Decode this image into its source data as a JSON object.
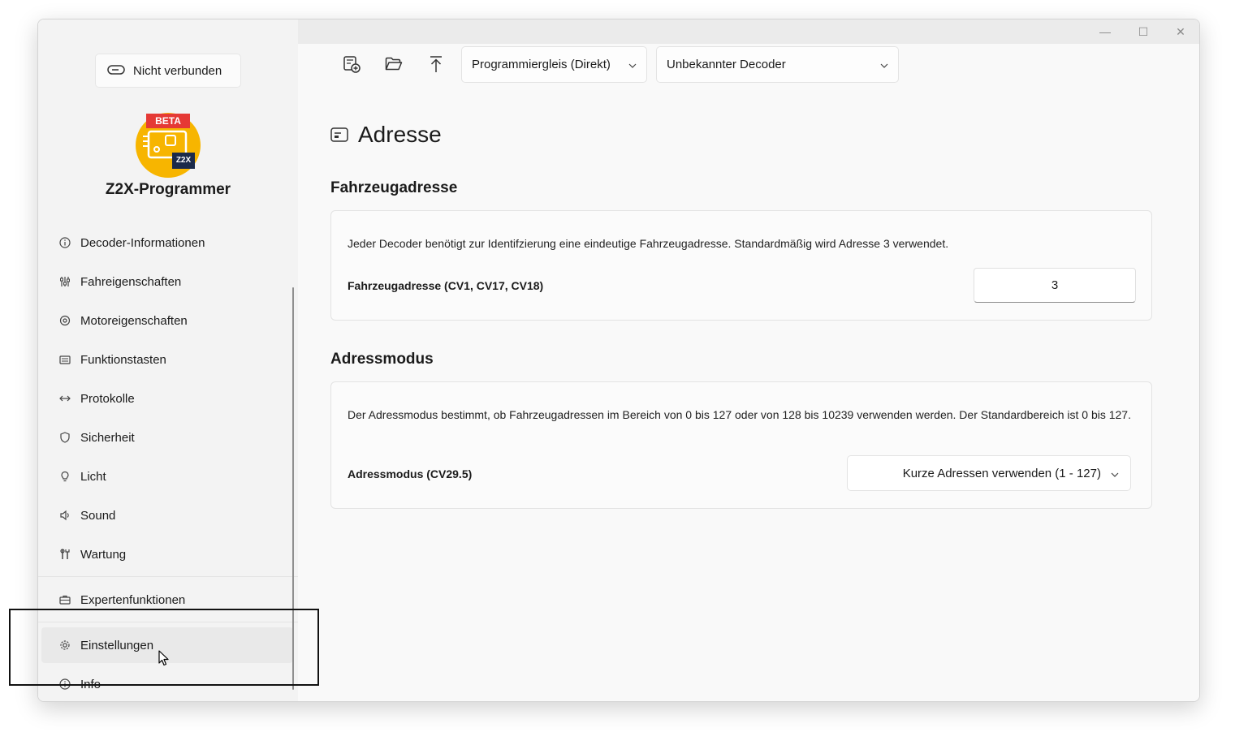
{
  "window": {
    "controls": {
      "minimize": "—",
      "maximize": "☐",
      "close": "✕"
    }
  },
  "sidebar": {
    "connection_label": "Nicht verbunden",
    "logo_badge": "BETA",
    "logo_text": "Z2X",
    "app_title": "Z2X-Programmer",
    "items": [
      {
        "label": "Decoder-Informationen",
        "icon": "info-icon"
      },
      {
        "label": "Fahreigenschaften",
        "icon": "tune-icon"
      },
      {
        "label": "Motoreigenschaften",
        "icon": "motor-icon"
      },
      {
        "label": "Funktionstasten",
        "icon": "keyboard-icon"
      },
      {
        "label": "Protokolle",
        "icon": "arrows-icon"
      },
      {
        "label": "Sicherheit",
        "icon": "shield-icon"
      },
      {
        "label": "Licht",
        "icon": "bulb-icon"
      },
      {
        "label": "Sound",
        "icon": "speaker-icon"
      },
      {
        "label": "Wartung",
        "icon": "wrench-icon"
      }
    ],
    "expert_label": "Expertenfunktionen",
    "settings_label": "Einstellungen",
    "info_label": "Info"
  },
  "toolbar": {
    "track_select": "Programmiergleis (Direkt)",
    "decoder_select": "Unbekannter Decoder"
  },
  "page": {
    "title": "Adresse",
    "vehicle_section": {
      "title": "Fahrzeugadresse",
      "description": "Jeder Decoder benötigt zur Identifzierung eine eindeutige Fahrzeugadresse. Standardmäßig wird Adresse 3 verwendet.",
      "field_label": "Fahrzeugadresse (CV1, CV17, CV18)",
      "field_value": "3"
    },
    "mode_section": {
      "title": "Adressmodus",
      "description": "Der Adressmodus bestimmt, ob Fahrzeugadressen im Bereich von 0 bis 127 oder von 128 bis 10239 verwenden werden. Der Standardbereich ist 0 bis 127.",
      "field_label": "Adressmodus (CV29.5)",
      "field_value": "Kurze Adressen verwenden (1 - 127)"
    }
  },
  "colors": {
    "accent_logo": "#f7b500",
    "badge": "#e53935",
    "logo_dark": "#1b2a4a"
  }
}
